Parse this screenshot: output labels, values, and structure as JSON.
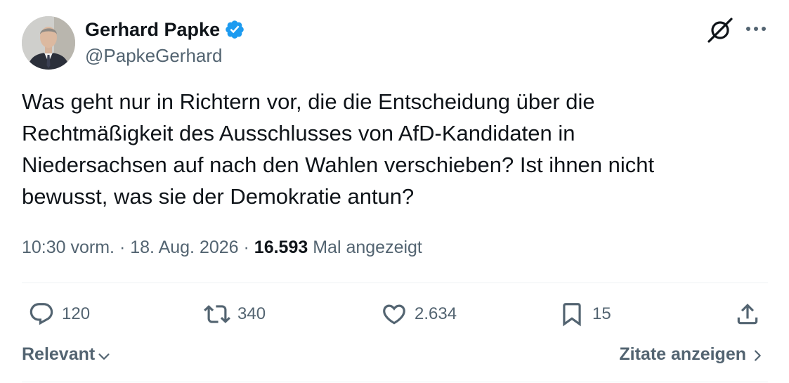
{
  "author": {
    "name": "Gerhard Papke",
    "handle": "@PapkeGerhard"
  },
  "tweet": {
    "text": "Was geht nur in Richtern vor, die die Entscheidung über die\nRechtmäßigkeit des Ausschlusses von AfD-Kandidaten in\nNiedersachsen auf nach den Wahlen verschieben? Ist ihnen nicht\nbewusst, was sie der Demokratie antun?",
    "time": "10:30 vorm.",
    "separator": "·",
    "date": "18. Aug. 2026",
    "views_count": "16.593",
    "views_label": "Mal angezeigt"
  },
  "actions": {
    "replies": "120",
    "reposts": "340",
    "likes": "2.634",
    "bookmarks": "15"
  },
  "footer": {
    "sort_label": "Relevant",
    "quotes_label": "Zitate anzeigen"
  },
  "icons": {
    "verified": "verified-badge-icon",
    "grok": "grok-icon",
    "more": "more-icon",
    "reply": "reply-icon",
    "repost": "repost-icon",
    "like": "like-icon",
    "bookmark": "bookmark-icon",
    "share": "share-icon"
  },
  "colors": {
    "text": "#0f1419",
    "secondary": "#536471",
    "verified": "#1d9bf0",
    "divider": "#eff3f4"
  }
}
